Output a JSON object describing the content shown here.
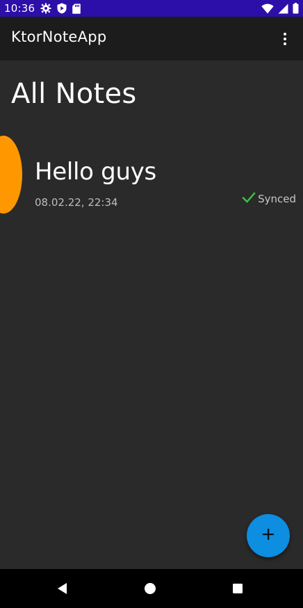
{
  "status_bar": {
    "time": "10:36",
    "left_icons": [
      "gear-icon",
      "shield-play-icon",
      "sd-card-icon"
    ],
    "right_icons": [
      "wifi-icon",
      "signal-icon",
      "battery-icon"
    ],
    "background": "#2b0fa8"
  },
  "app_bar": {
    "title": "KtorNoteApp",
    "overflow_icon": "more-vert-icon"
  },
  "main": {
    "heading": "All Notes",
    "notes": [
      {
        "title": "Hello guys",
        "date": "08.02.22, 22:34",
        "sync_label": "Synced",
        "sync_icon": "checkmark-icon",
        "color": "#ff9800"
      }
    ]
  },
  "fab": {
    "icon": "plus-icon",
    "color": "#0d8ee0"
  },
  "nav_bar": {
    "buttons": [
      "back-icon",
      "home-icon",
      "recents-icon"
    ]
  },
  "colors": {
    "background": "#2a2a2a",
    "app_bar": "#1c1c1c",
    "sync_check": "#3fc33f"
  }
}
